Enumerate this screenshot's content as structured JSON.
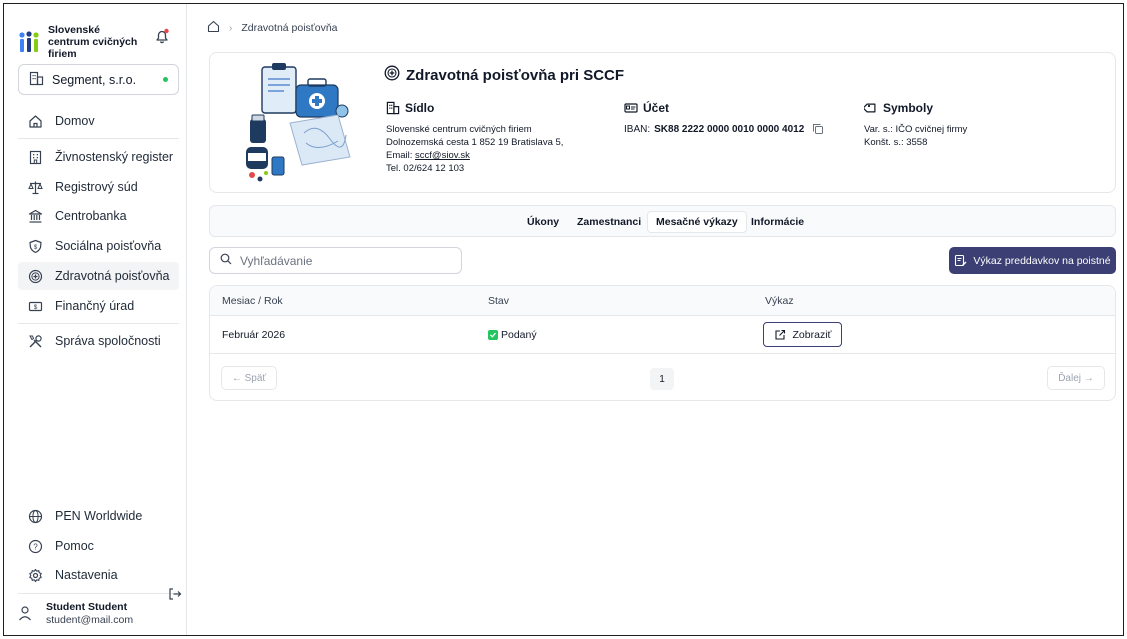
{
  "sidebar": {
    "brand": "Slovenské centrum cvičných firiem",
    "company": "Segment, s.r.o.",
    "items": [
      {
        "label": "Domov",
        "icon": "home-icon"
      },
      {
        "label": "Živnostenský register",
        "icon": "building-icon"
      },
      {
        "label": "Registrový súd",
        "icon": "scales-icon"
      },
      {
        "label": "Centrobanka",
        "icon": "bank-icon"
      },
      {
        "label": "Sociálna poisťovňa",
        "icon": "shield-icon"
      },
      {
        "label": "Zdravotná poisťovňa",
        "icon": "medical-plus-icon"
      },
      {
        "label": "Finančný úrad",
        "icon": "money-icon"
      },
      {
        "label": "Správa spoločnosti",
        "icon": "tools-icon"
      }
    ],
    "bottom_items": [
      {
        "label": "PEN Worldwide",
        "icon": "globe-icon"
      },
      {
        "label": "Pomoc",
        "icon": "help-icon"
      },
      {
        "label": "Nastavenia",
        "icon": "gear-icon"
      }
    ],
    "user": {
      "name": "Student Student",
      "email": "student@mail.com"
    }
  },
  "breadcrumb": {
    "current": "Zdravotná poisťovňa"
  },
  "header_card": {
    "title": "Zdravotná poisťovňa pri SCCF",
    "sidlo": {
      "label": "Sídlo",
      "line1": "Slovenské centrum cvičných firiem",
      "line2": "Dolnozemská cesta 1 852 19 Bratislava 5,",
      "email_label": "Email:",
      "email": "sccf@siov.sk",
      "phone": "Tel. 02/624 12 103"
    },
    "ucet": {
      "label": "Účet",
      "iban_label": "IBAN:",
      "iban": "SK88 2222 0000 0010 0000 4012"
    },
    "symboly": {
      "label": "Symboly",
      "var": "Var. s.: IČO cvičnej firmy",
      "konst": "Konšt. s.: 3558"
    }
  },
  "tabs": [
    {
      "label": "Úkony"
    },
    {
      "label": "Zamestnanci"
    },
    {
      "label": "Mesačné výkazy",
      "active": true
    },
    {
      "label": "Informácie"
    }
  ],
  "search": {
    "placeholder": "Vyhľadávanie"
  },
  "primary_button": "Výkaz preddavkov na poistné",
  "table": {
    "columns": [
      "Mesiac / Rok",
      "Stav",
      "Výkaz"
    ],
    "rows": [
      {
        "month": "Február 2026",
        "status": "Podaný",
        "action": "Zobraziť"
      }
    ]
  },
  "pagination": {
    "prev": "← Späť",
    "page": "1",
    "next": "Ďalej →"
  },
  "colors": {
    "primary": "#3b3f73",
    "success": "#22c55e",
    "border": "#e5e7eb",
    "notification": "#ef4444"
  }
}
